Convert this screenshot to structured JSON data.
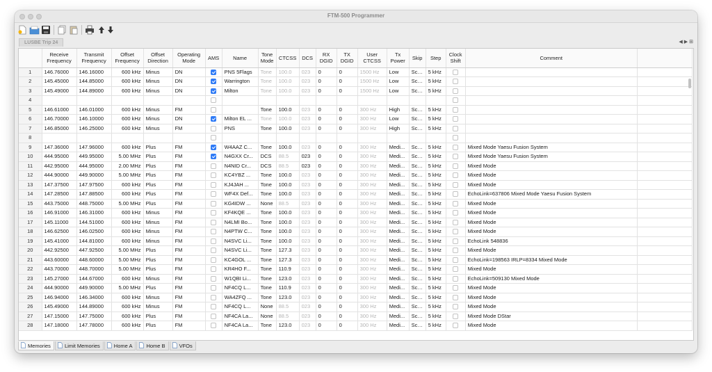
{
  "window": {
    "title": "FTM-500 Programmer"
  },
  "file_tab": "LUSBE Trip 24",
  "columns": [
    "",
    "Receive\nFrequency",
    "Transmit\nFrequency",
    "Offset\nFrequency",
    "Offset\nDirection",
    "Operating\nMode",
    "AMS",
    "Name",
    "Tone\nMode",
    "CTCSS",
    "DCS",
    "RX\nDGID",
    "TX\nDGID",
    "User\nCTCSS",
    "Tx\nPower",
    "Skip",
    "Step",
    "Clock\nShift",
    "Comment"
  ],
  "rows": [
    [
      "1",
      "146.76000",
      "146.16000",
      "600 kHz",
      "Minus",
      "DN",
      true,
      "PNS 5Flags",
      "Tone",
      "100.0",
      "023",
      "0",
      "0",
      "1500 Hz",
      "Low",
      "Scan",
      "5 kHz",
      false,
      ""
    ],
    [
      "2",
      "145.45000",
      "144.85000",
      "600 kHz",
      "Minus",
      "DN",
      true,
      "Warrington",
      "Tone",
      "100.0",
      "023",
      "0",
      "0",
      "1500 Hz",
      "Low",
      "Scan",
      "5 kHz",
      false,
      ""
    ],
    [
      "3",
      "145.49000",
      "144.89000",
      "600 kHz",
      "Minus",
      "DN",
      true,
      "Milton",
      "Tone",
      "100.0",
      "023",
      "0",
      "0",
      "1500 Hz",
      "Low",
      "Scan",
      "5 kHz",
      false,
      ""
    ],
    [
      "4",
      "",
      "",
      "",
      "",
      "",
      false,
      "",
      "",
      "",
      "",
      "",
      "",
      "",
      "",
      "",
      "",
      false,
      ""
    ],
    [
      "5",
      "146.61000",
      "146.01000",
      "600 kHz",
      "Minus",
      "FM",
      false,
      "",
      "Tone",
      "100.0",
      "023",
      "0",
      "0",
      "300 Hz",
      "High",
      "Scan",
      "5 kHz",
      false,
      ""
    ],
    [
      "6",
      "146.70000",
      "146.10000",
      "600 kHz",
      "Minus",
      "DN",
      true,
      "Milton EL ...",
      "Tone",
      "100.0",
      "023",
      "0",
      "0",
      "300 Hz",
      "Low",
      "Scan",
      "5 kHz",
      false,
      ""
    ],
    [
      "7",
      "146.85000",
      "146.25000",
      "600 kHz",
      "Minus",
      "FM",
      false,
      "PNS",
      "Tone",
      "100.0",
      "023",
      "0",
      "0",
      "300 Hz",
      "High",
      "Scan",
      "5 kHz",
      false,
      ""
    ],
    [
      "8",
      "",
      "",
      "",
      "",
      "",
      false,
      "",
      "",
      "",
      "",
      "",
      "",
      "",
      "",
      "",
      "",
      false,
      ""
    ],
    [
      "9",
      "147.36000",
      "147.96000",
      "600 kHz",
      "Plus",
      "FM",
      true,
      "W4AAZ C...",
      "Tone",
      "100.0",
      "023",
      "0",
      "0",
      "300 Hz",
      "Medi...",
      "Scan",
      "5 kHz",
      false,
      "Mixed Mode Yaesu Fusion System"
    ],
    [
      "10",
      "444.95000",
      "449.95000",
      "5.00 MHz",
      "Plus",
      "FM",
      true,
      "N4GXX Cr...",
      "DCS",
      "88.5",
      "023",
      "0",
      "0",
      "300 Hz",
      "Medi...",
      "Scan",
      "5 kHz",
      false,
      "Mixed Mode Yaesu Fusion System"
    ],
    [
      "11",
      "442.95000",
      "444.95000",
      "2.00 MHz",
      "Plus",
      "FM",
      false,
      "N4NID Cr...",
      "DCS",
      "88.5",
      "023",
      "0",
      "0",
      "300 Hz",
      "Medi...",
      "Scan",
      "5 kHz",
      false,
      "Mixed Mode"
    ],
    [
      "12",
      "444.90000",
      "449.90000",
      "5.00 MHz",
      "Plus",
      "FM",
      false,
      "KC4YBZ ...",
      "Tone",
      "100.0",
      "023",
      "0",
      "0",
      "300 Hz",
      "Medi...",
      "Scan",
      "5 kHz",
      false,
      "Mixed Mode"
    ],
    [
      "13",
      "147.37500",
      "147.97500",
      "600 kHz",
      "Plus",
      "FM",
      false,
      "KJ4JAH ...",
      "Tone",
      "100.0",
      "023",
      "0",
      "0",
      "300 Hz",
      "Medi...",
      "Scan",
      "5 kHz",
      false,
      "Mixed Mode"
    ],
    [
      "14",
      "147.28500",
      "147.88500",
      "600 kHz",
      "Plus",
      "FM",
      false,
      "WF4X Def...",
      "Tone",
      "100.0",
      "023",
      "0",
      "0",
      "300 Hz",
      "Medi...",
      "Scan",
      "5 kHz",
      false,
      "EchoLink=637806 Mixed Mode Yaesu Fusion System"
    ],
    [
      "15",
      "443.75000",
      "448.75000",
      "5.00 MHz",
      "Plus",
      "FM",
      false,
      "KG4IDW ...",
      "None",
      "88.5",
      "023",
      "0",
      "0",
      "300 Hz",
      "Medi...",
      "Scan",
      "5 kHz",
      false,
      "Mixed Mode"
    ],
    [
      "16",
      "146.91000",
      "146.31000",
      "600 kHz",
      "Minus",
      "FM",
      false,
      "KF4KQE ...",
      "Tone",
      "100.0",
      "023",
      "0",
      "0",
      "300 Hz",
      "Medi...",
      "Scan",
      "5 kHz",
      false,
      "Mixed Mode"
    ],
    [
      "17",
      "145.11000",
      "144.51000",
      "600 kHz",
      "Minus",
      "FM",
      false,
      "N4LMI Bo...",
      "Tone",
      "100.0",
      "023",
      "0",
      "0",
      "300 Hz",
      "Medi...",
      "Scan",
      "5 kHz",
      false,
      "Mixed Mode"
    ],
    [
      "18",
      "146.62500",
      "146.02500",
      "600 kHz",
      "Minus",
      "FM",
      false,
      "N4PTW C...",
      "Tone",
      "100.0",
      "023",
      "0",
      "0",
      "300 Hz",
      "Medi...",
      "Scan",
      "5 kHz",
      false,
      "Mixed Mode"
    ],
    [
      "19",
      "145.41000",
      "144.81000",
      "600 kHz",
      "Minus",
      "FM",
      false,
      "N4SVC Li...",
      "Tone",
      "100.0",
      "023",
      "0",
      "0",
      "300 Hz",
      "Medi...",
      "Scan",
      "5 kHz",
      false,
      "EchoLink 548836"
    ],
    [
      "20",
      "442.92500",
      "447.92500",
      "5.00 MHz",
      "Plus",
      "FM",
      false,
      "N4SVC Li...",
      "Tone",
      "127.3",
      "023",
      "0",
      "0",
      "300 Hz",
      "Medi...",
      "Scan",
      "5 kHz",
      false,
      "Mixed Mode"
    ],
    [
      "21",
      "443.60000",
      "448.60000",
      "5.00 MHz",
      "Plus",
      "FM",
      false,
      "KC4GOL ...",
      "Tone",
      "127.3",
      "023",
      "0",
      "0",
      "300 Hz",
      "Medi...",
      "Scan",
      "5 kHz",
      false,
      "EchoLink=198563 IRLP=8334 Mixed Mode"
    ],
    [
      "22",
      "443.70000",
      "448.70000",
      "5.00 MHz",
      "Plus",
      "FM",
      false,
      "KR4HO F...",
      "Tone",
      "110.9",
      "023",
      "0",
      "0",
      "300 Hz",
      "Medi...",
      "Scan",
      "5 kHz",
      false,
      "Mixed Mode"
    ],
    [
      "23",
      "145.27000",
      "144.67000",
      "600 kHz",
      "Minus",
      "FM",
      false,
      "W1QBI Li...",
      "Tone",
      "123.0",
      "023",
      "0",
      "0",
      "300 Hz",
      "Medi...",
      "Scan",
      "5 kHz",
      false,
      "EchoLink=509130 Mixed Mode"
    ],
    [
      "24",
      "444.90000",
      "449.90000",
      "5.00 MHz",
      "Plus",
      "FM",
      false,
      "NF4CQ L...",
      "Tone",
      "110.9",
      "023",
      "0",
      "0",
      "300 Hz",
      "Medi...",
      "Scan",
      "5 kHz",
      false,
      "Mixed Mode"
    ],
    [
      "25",
      "146.94000",
      "146.34000",
      "600 kHz",
      "Minus",
      "FM",
      false,
      "WA4ZFQ ...",
      "Tone",
      "123.0",
      "023",
      "0",
      "0",
      "300 Hz",
      "Medi...",
      "Scan",
      "5 kHz",
      false,
      "Mixed Mode"
    ],
    [
      "26",
      "145.49000",
      "144.89000",
      "600 kHz",
      "Minus",
      "FM",
      false,
      "NF4CQ L...",
      "None",
      "88.5",
      "023",
      "0",
      "0",
      "300 Hz",
      "Medi...",
      "Scan",
      "5 kHz",
      false,
      "Mixed Mode"
    ],
    [
      "27",
      "147.15000",
      "147.75000",
      "600 kHz",
      "Plus",
      "FM",
      false,
      "NF4CA La...",
      "None",
      "88.5",
      "023",
      "0",
      "0",
      "300 Hz",
      "Medi...",
      "Scan",
      "5 kHz",
      false,
      "Mixed Mode DStar"
    ],
    [
      "28",
      "147.18000",
      "147.78000",
      "600 kHz",
      "Plus",
      "FM",
      false,
      "NF4CA La...",
      "Tone",
      "123.0",
      "023",
      "0",
      "0",
      "300 Hz",
      "Medi...",
      "Scan",
      "5 kHz",
      false,
      "Mixed Mode"
    ]
  ],
  "sheet_tabs": [
    "Memories",
    "Limit Memories",
    "Home A",
    "Home B",
    "VFOs"
  ],
  "colors": {
    "checkbox_on": "#2f7bf6",
    "dim_text": "#b4b4b4"
  }
}
